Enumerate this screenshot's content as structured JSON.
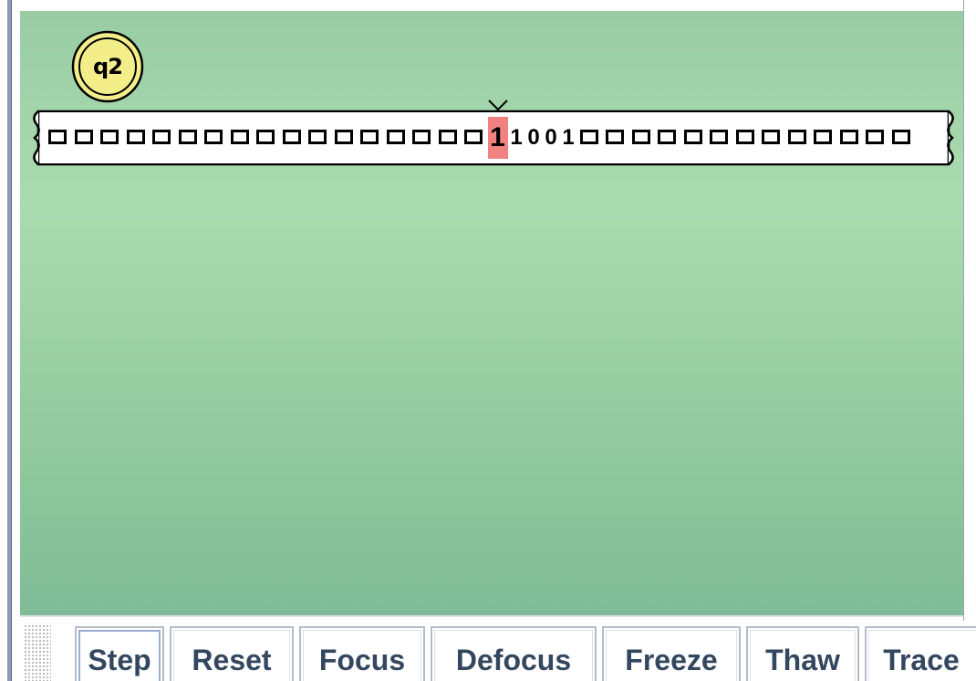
{
  "state": {
    "label": "q2"
  },
  "tape": {
    "left_blanks": 17,
    "head_symbol": "1",
    "right_symbols": [
      "1",
      "0",
      "0",
      "1"
    ],
    "right_blanks": 13,
    "head_highlight_color": "#f08282"
  },
  "controls": {
    "buttons": [
      {
        "id": "step",
        "label": "Step"
      },
      {
        "id": "reset",
        "label": "Reset"
      },
      {
        "id": "focus",
        "label": "Focus"
      },
      {
        "id": "defocus",
        "label": "Defocus"
      },
      {
        "id": "freeze",
        "label": "Freeze"
      },
      {
        "id": "thaw",
        "label": "Thaw"
      },
      {
        "id": "trace",
        "label": "Trace"
      }
    ]
  },
  "colors": {
    "canvas_top": "#98cca3",
    "canvas_bottom": "#7fbc97",
    "state_fill": "#f3ee8a",
    "button_text": "#33475f"
  }
}
